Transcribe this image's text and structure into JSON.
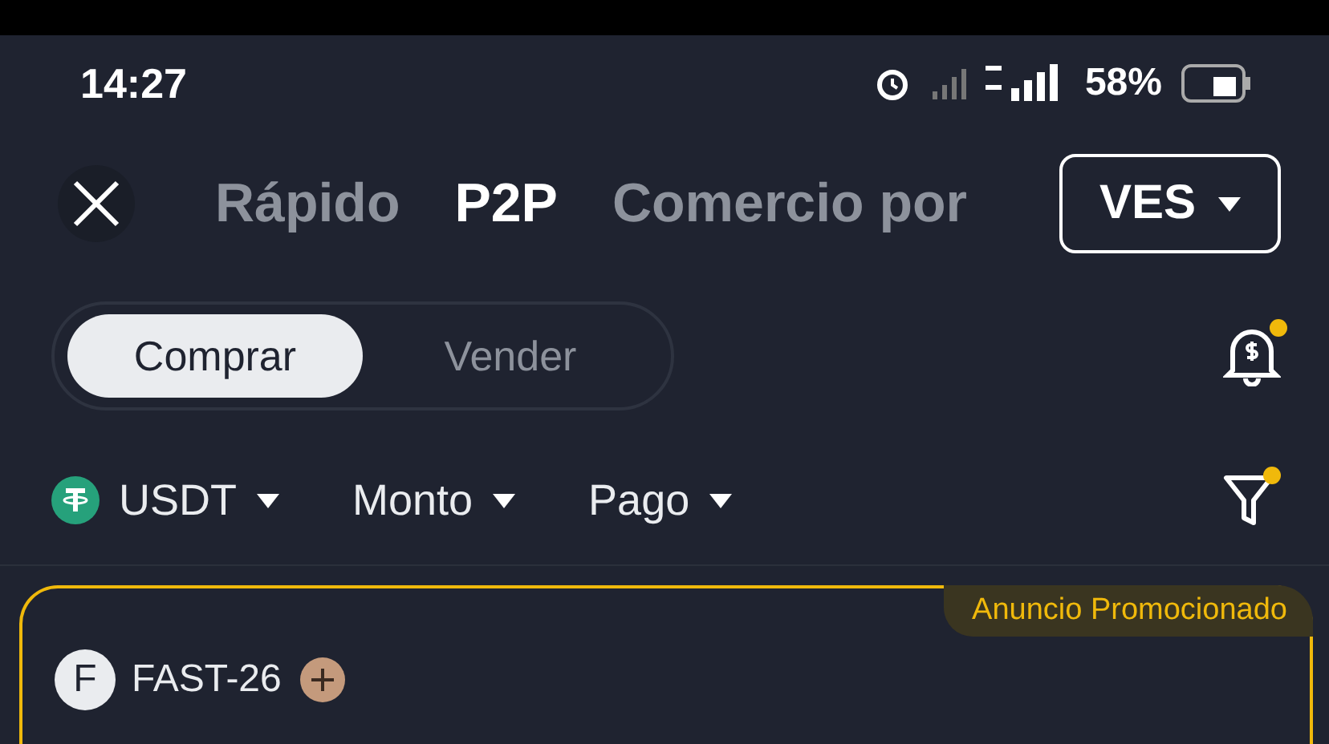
{
  "status_bar": {
    "time": "14:27",
    "battery": "58%"
  },
  "header": {
    "tabs": [
      {
        "label": "Rápido",
        "selected": false
      },
      {
        "label": "P2P",
        "selected": true
      },
      {
        "label": "Comercio por",
        "selected": false
      }
    ],
    "currency": "VES"
  },
  "trade_toggle": [
    {
      "label": "Comprar",
      "selected": true
    },
    {
      "label": "Vender",
      "selected": false
    }
  ],
  "notification_dot": true,
  "filters": [
    {
      "label": "USDT",
      "kind": "coin"
    },
    {
      "label": "Monto",
      "kind": "plain"
    },
    {
      "label": "Pago",
      "kind": "plain"
    }
  ],
  "filter_dot": true,
  "ad": {
    "badge": "Anuncio Promocionado",
    "avatar": "F",
    "merchant": "FAST-26"
  }
}
